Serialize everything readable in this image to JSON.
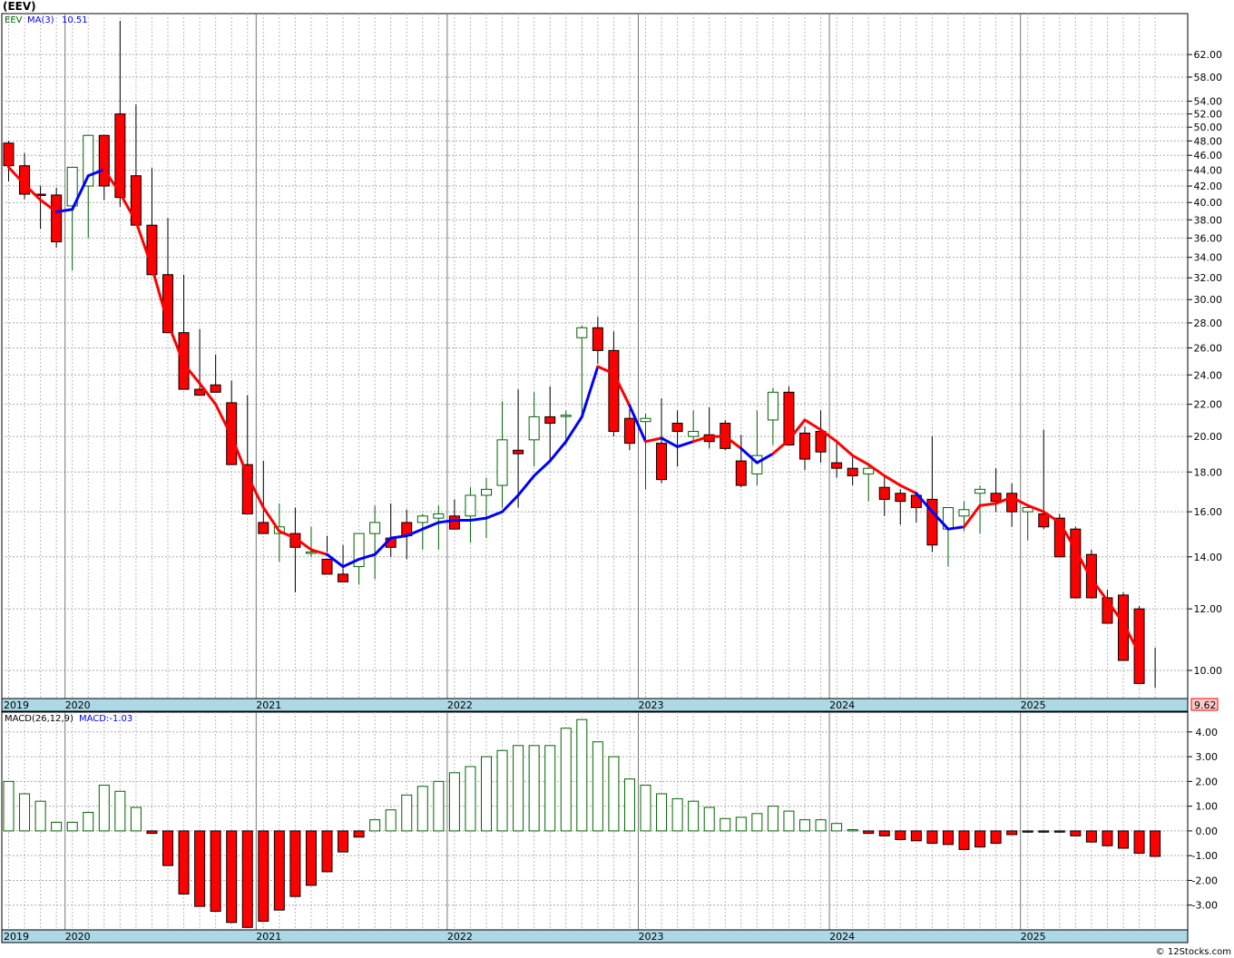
{
  "symbol_title": "(EEV)",
  "price_legend": {
    "symbol": "EEV",
    "ma_label": "MA(3)",
    "ma_value": "10.51"
  },
  "macd_legend": {
    "label": "MACD(26,12,9)",
    "value_label": "MACD:-1.03"
  },
  "last_price_label": "9.62",
  "footer": "© 12Stocks.com",
  "colors": {
    "up_candle": "#006400",
    "down_candle": "#ff0000",
    "ma_rising": "#0000ff",
    "ma_falling": "#ff0000",
    "axis_band": "#add8e6",
    "grid": "#999999"
  },
  "chart_data": [
    {
      "type": "candlestick",
      "scale": "log",
      "ylim": [
        9.2,
        70
      ],
      "yticks": [
        62,
        58,
        54,
        52,
        50,
        48,
        46,
        44,
        42,
        40,
        38,
        36,
        34,
        32,
        30,
        28,
        26,
        24,
        22,
        20,
        18,
        16,
        14,
        12,
        10
      ],
      "year_labels": [
        "2019",
        "2020",
        "2021",
        "2022",
        "2023",
        "2024",
        "2025"
      ],
      "year_start_index": [
        0,
        4,
        16,
        28,
        40,
        52,
        64
      ],
      "series_o": [
        47.7,
        44.6,
        41.0,
        40.9,
        39.6,
        42.0,
        48.8,
        52.0,
        43.3,
        37.4,
        32.3,
        27.2,
        23.0,
        23.3,
        22.1,
        18.4,
        15.5,
        15.0,
        15.0,
        14.2,
        13.9,
        13.3,
        13.6,
        15.0,
        14.8,
        15.5,
        15.5,
        15.7,
        15.8,
        15.8,
        16.8,
        17.3,
        19.2,
        19.8,
        21.2,
        21.3,
        26.8,
        27.6,
        25.8,
        21.1,
        20.9,
        19.6,
        20.8,
        20.0,
        20.1,
        20.8,
        18.6,
        17.9,
        21.0,
        22.8,
        20.2,
        20.3,
        18.5,
        18.2,
        17.9,
        17.2,
        16.9,
        16.8,
        16.6,
        15.2,
        15.8,
        16.9,
        16.9,
        16.9,
        16.0,
        15.9,
        15.7,
        15.2,
        14.1,
        12.4,
        12.5,
        12.0,
        10.0
      ],
      "series_c": [
        44.6,
        41.0,
        40.9,
        35.6,
        44.4,
        48.8,
        42.0,
        40.6,
        37.4,
        32.3,
        27.2,
        23.0,
        22.6,
        22.8,
        18.4,
        15.9,
        15.0,
        15.3,
        14.4,
        14.2,
        13.3,
        13.0,
        15.0,
        15.5,
        14.4,
        14.9,
        15.8,
        15.9,
        15.2,
        16.8,
        17.1,
        19.8,
        19.0,
        21.2,
        20.8,
        21.3,
        27.6,
        25.8,
        20.3,
        19.6,
        21.1,
        17.6,
        20.3,
        20.3,
        19.7,
        19.3,
        17.3,
        18.9,
        22.8,
        19.5,
        18.7,
        19.1,
        18.2,
        17.8,
        18.2,
        16.6,
        16.5,
        16.2,
        14.5,
        16.2,
        16.1,
        17.1,
        16.5,
        16.0,
        16.2,
        15.3,
        14.0,
        12.4,
        12.4,
        11.5,
        10.3,
        9.62
      ],
      "series_h": [
        48.0,
        46.3,
        42.0,
        41.8,
        40.0,
        44.8,
        48.5,
        68.5,
        53.5,
        44.3,
        38.2,
        32.3,
        27.5,
        25.5,
        23.6,
        22.6,
        18.6,
        16.4,
        16.2,
        15.3,
        14.9,
        14.5,
        13.6,
        16.3,
        16.4,
        16.1,
        15.9,
        16.3,
        16.6,
        17.2,
        17.7,
        22.2,
        23.0,
        22.8,
        23.2,
        21.6,
        27.8,
        28.5,
        27.3,
        21.7,
        21.4,
        22.4,
        21.6,
        21.6,
        21.8,
        21.0,
        20.1,
        21.6,
        23.1,
        23.2,
        20.6,
        21.6,
        19.6,
        18.8,
        18.4,
        17.8,
        17.1,
        16.8,
        20.0,
        15.7,
        16.5,
        17.3,
        18.2,
        17.4,
        16.3,
        20.4,
        15.9,
        15.3,
        14.3,
        12.7,
        12.6,
        12.1,
        10.7
      ],
      "series_l": [
        42.6,
        40.4,
        37.0,
        35.0,
        32.7,
        36.0,
        40.3,
        39.5,
        41.5,
        36.7,
        31.3,
        26.5,
        22.6,
        22.8,
        21.8,
        17.8,
        15.0,
        13.8,
        12.6,
        14.0,
        14.2,
        13.2,
        12.9,
        13.1,
        14.0,
        13.9,
        14.3,
        14.3,
        15.3,
        14.6,
        14.8,
        16.2,
        16.2,
        18.3,
        18.6,
        19.5,
        21.1,
        24.8,
        20.0,
        19.2,
        17.1,
        17.4,
        18.3,
        19.8,
        19.3,
        19.2,
        17.2,
        17.3,
        19.5,
        19.8,
        18.1,
        18.5,
        17.7,
        17.3,
        16.5,
        15.8,
        15.4,
        15.5,
        14.2,
        13.6,
        15.1,
        15.0,
        16.0,
        15.3,
        14.7,
        15.2,
        14.4,
        13.4,
        12.4,
        12.2,
        11.5,
        10.1,
        9.5
      ],
      "ma": [
        44.4,
        42.2,
        40.3,
        38.9,
        39.2,
        43.3,
        44.1,
        41.1,
        37.8,
        33.0,
        28.0,
        24.8,
        23.4,
        22.0,
        20.0,
        17.8,
        16.2,
        15.1,
        14.8,
        14.3,
        14.1,
        13.6,
        13.9,
        14.1,
        14.8,
        14.9,
        15.2,
        15.5,
        15.6,
        15.6,
        15.7,
        16.0,
        16.8,
        17.8,
        18.6,
        19.7,
        21.2,
        24.6,
        24.1,
        21.9,
        19.7,
        19.9,
        19.4,
        19.7,
        20.0,
        20.0,
        19.3,
        18.5,
        19.0,
        19.8,
        21.0,
        20.4,
        19.7,
        18.9,
        18.4,
        17.8,
        17.3,
        16.9,
        16.0,
        15.2,
        15.3,
        16.3,
        16.4,
        16.7,
        16.3,
        16.0,
        15.5,
        14.3,
        13.1,
        12.3,
        11.5,
        10.51
      ],
      "ma_color": [
        "red",
        "red",
        "red",
        "red",
        "blue",
        "blue",
        "blue",
        "red",
        "red",
        "red",
        "red",
        "red",
        "red",
        "red",
        "red",
        "red",
        "red",
        "red",
        "red",
        "red",
        "red",
        "blue",
        "blue",
        "blue",
        "blue",
        "blue",
        "blue",
        "blue",
        "blue",
        "blue",
        "blue",
        "blue",
        "blue",
        "blue",
        "blue",
        "blue",
        "blue",
        "blue",
        "red",
        "red",
        "blue",
        "red",
        "blue",
        "blue",
        "red",
        "red",
        "red",
        "blue",
        "blue",
        "red",
        "red",
        "red",
        "red",
        "red",
        "red",
        "red",
        "red",
        "red",
        "blue",
        "blue",
        "blue",
        "red",
        "red",
        "red",
        "red",
        "red",
        "red",
        "red",
        "red",
        "red",
        "red",
        "red"
      ]
    },
    {
      "type": "bar",
      "name": "MACD",
      "ylim": [
        -4.0,
        4.8
      ],
      "yticks": [
        4.0,
        3.0,
        2.0,
        1.0,
        0.0,
        -1.0,
        -2.0,
        -3.0
      ],
      "ytick_labels": [
        "4.00",
        "3.00",
        "2.00",
        "1.00",
        "0.00",
        "-1.00",
        "-2.00",
        "-3.00"
      ],
      "year_labels": [
        "2019",
        "2020",
        "2021",
        "2022",
        "2023",
        "2024",
        "2025"
      ],
      "values": [
        2.0,
        1.5,
        1.2,
        0.35,
        0.35,
        0.75,
        1.85,
        1.6,
        0.95,
        -0.1,
        -1.4,
        -2.55,
        -3.05,
        -3.25,
        -3.7,
        -3.9,
        -3.65,
        -3.2,
        -2.65,
        -2.2,
        -1.65,
        -0.85,
        -0.25,
        0.45,
        0.85,
        1.45,
        1.8,
        2.0,
        2.35,
        2.6,
        3.0,
        3.25,
        3.45,
        3.45,
        3.45,
        4.15,
        4.5,
        3.6,
        3.0,
        2.1,
        1.85,
        1.5,
        1.3,
        1.2,
        0.95,
        0.5,
        0.55,
        0.7,
        1.0,
        0.8,
        0.45,
        0.45,
        0.3,
        0.05,
        -0.1,
        -0.2,
        -0.35,
        -0.4,
        -0.5,
        -0.55,
        -0.75,
        -0.65,
        -0.5,
        -0.15,
        -0.05,
        -0.05,
        -0.05,
        -0.2,
        -0.45,
        -0.6,
        -0.7,
        -0.9,
        -1.03
      ]
    }
  ]
}
